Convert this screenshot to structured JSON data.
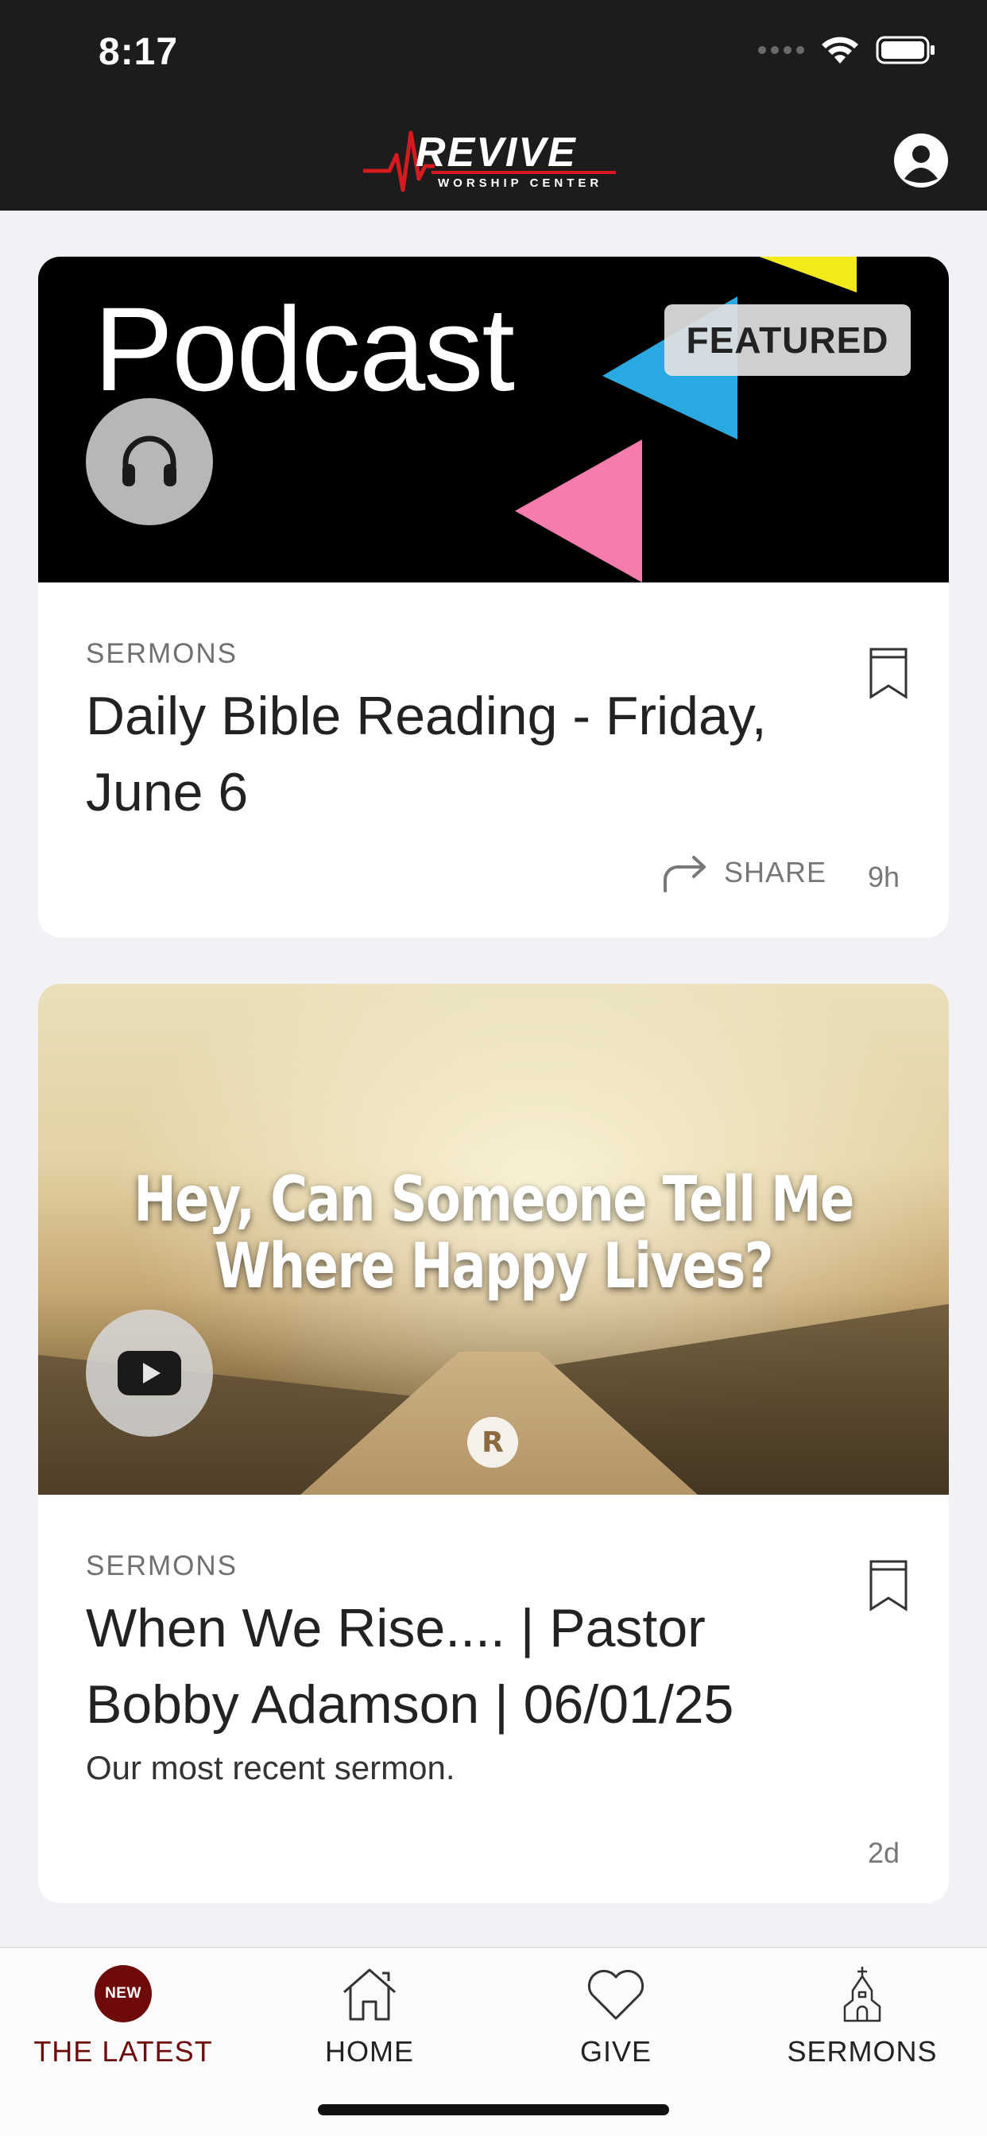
{
  "status_bar": {
    "time": "8:17"
  },
  "header": {
    "logo_text": "REVIVE",
    "logo_subtext": "WORSHIP CENTER"
  },
  "feed": {
    "cards": [
      {
        "image_title": "Podcast",
        "badge": "FEATURED",
        "media_icon": "headphones-icon",
        "category": "SERMONS",
        "title": "Daily Bible Reading - Friday, June 6",
        "share_label": "SHARE",
        "age": "9h"
      },
      {
        "image_title": "Hey, Can Someone Tell Me Where Happy Lives?",
        "media_icon": "youtube-play-icon",
        "category": "SERMONS",
        "title": "When We Rise.... | Pastor Bobby Adamson | 06/01/25",
        "description": "Our most recent sermon.",
        "age": "2d"
      }
    ]
  },
  "tab_bar": {
    "tabs": [
      {
        "label": "THE LATEST",
        "badge": "NEW",
        "active": true
      },
      {
        "label": "HOME",
        "icon": "house-icon"
      },
      {
        "label": "GIVE",
        "icon": "heart-icon"
      },
      {
        "label": "SERMONS",
        "icon": "church-icon"
      }
    ]
  },
  "colors": {
    "header_bg": "#1c1c1c",
    "accent": "#6e0a0a",
    "logo_red": "#d71920",
    "background": "#f2f2f6"
  }
}
